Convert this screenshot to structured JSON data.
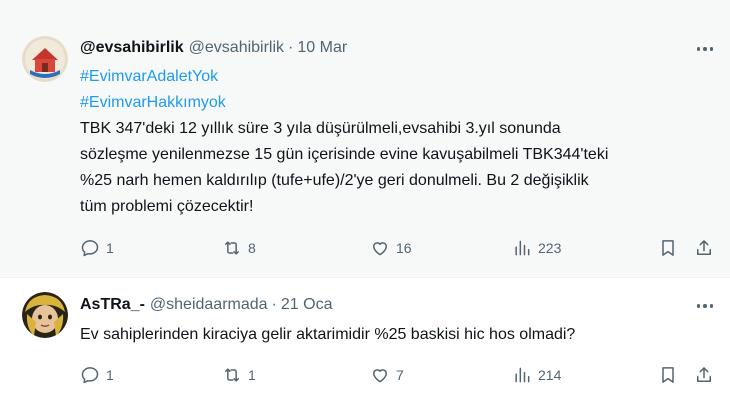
{
  "tweets": [
    {
      "display_name": "@evsahibirlik",
      "handle": "@evsahibirlik",
      "separator": "·",
      "date": "10 Mar",
      "hashtags": [
        "#EvimvarAdaletYok",
        "#EvimvarHakkımyok"
      ],
      "text_lines": [
        "TBK 347'deki 12 yıllık süre 3 yıla düşürülmeli,evsahibi 3.yıl sonunda",
        "sözleşme yenilenmezse 15 gün içerisinde evine kavuşabilmeli TBK344'teki",
        "%25 narh hemen kaldırılıp (tufe+ufe)/2'ye geri donulmeli. Bu 2 değişiklik",
        "tüm problemi çözecektir!"
      ],
      "stats": {
        "replies": "1",
        "retweets": "8",
        "likes": "16",
        "views": "223"
      }
    },
    {
      "display_name": "AsTRa_-",
      "handle": "@sheidaarmada",
      "separator": "·",
      "date": "21 Oca",
      "text_lines": [
        "Ev sahiplerinden kiraciya gelir aktarimidir %25 baskisi hic hos olmadi?"
      ],
      "stats": {
        "replies": "1",
        "retweets": "1",
        "likes": "7",
        "views": "214"
      }
    }
  ],
  "icons": {
    "reply": "reply-icon",
    "retweet": "retweet-icon",
    "like": "heart-icon",
    "views": "views-icon",
    "bookmark": "bookmark-icon",
    "share": "share-icon",
    "more": "more-icon"
  },
  "colors": {
    "hashtag": "#1d9bf0",
    "secondary_text": "#536471",
    "primary_text": "#0f1419",
    "main_background": "#f7f9f9"
  }
}
